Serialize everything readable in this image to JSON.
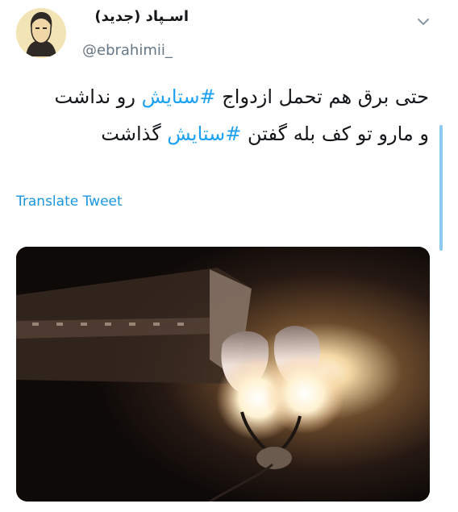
{
  "tweet": {
    "author_name": "اسـپاد (جدید)",
    "author_handle": "@ebrahimii_",
    "text_line1_prefix": "حتی برق هم تحمل ازدواج ",
    "hashtag_1": "#ستایش",
    "text_line1_suffix": " رو نداشت",
    "text_line2_prefix": "و مارو تو کف بله گفتن ",
    "hashtag_2": "#ستایش",
    "text_line2_suffix": " گذاشت",
    "translate_label": "Translate Tweet"
  },
  "icons": {
    "avatar": "avatar-illustration",
    "menu": "chevron-down-icon"
  },
  "colors": {
    "hashtag": "#1da1f2",
    "translate_link": "#1b95e0",
    "handle": "#657786",
    "scrollbar": "#8ec9f2"
  }
}
